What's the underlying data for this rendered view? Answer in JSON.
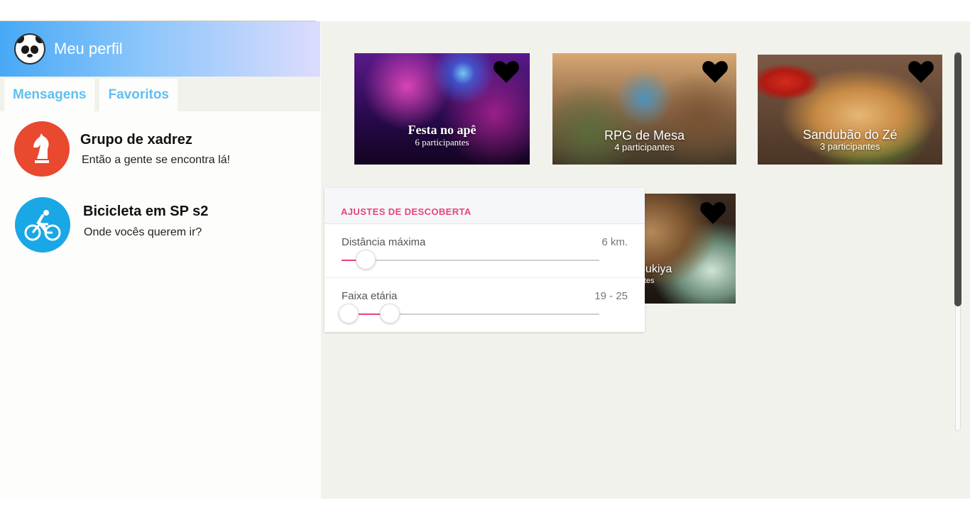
{
  "profile": {
    "title": "Meu perfil",
    "avatar_icon": "panda-icon"
  },
  "tabs": [
    {
      "label": "Mensagens"
    },
    {
      "label": "Favoritos"
    }
  ],
  "chats": [
    {
      "name": "Grupo de xadrez",
      "last_message": "Então a gente se encontra lá!",
      "icon": "chess-knight-icon",
      "color": "#e8492f"
    },
    {
      "name": "Bicicleta em SP s2",
      "last_message": "Onde vocês querem ir?",
      "icon": "cyclist-icon",
      "color": "#1aa7e5"
    }
  ],
  "cards": [
    {
      "title": "Festa no apê",
      "subtitle": "6 participantes",
      "favorite_icon": "heart-icon"
    },
    {
      "title": "RPG de Mesa",
      "subtitle": "4 participantes",
      "favorite_icon": "heart-icon"
    },
    {
      "title": "Sandubão do Zé",
      "subtitle": "3 participantes",
      "favorite_icon": "heart-icon"
    },
    {
      "title": "no Sukiya",
      "subtitle": "ipantes",
      "favorite_icon": "heart-icon"
    }
  ],
  "discovery": {
    "title": "AJUSTES DE DESCOBERTA",
    "max_distance": {
      "label": "Distância máxima",
      "value_text": "6 km.",
      "fraction": 0.05
    },
    "age_range": {
      "label": "Faixa etária",
      "value_text": "19 - 25",
      "low_fraction": 0.0,
      "high_fraction": 0.16
    }
  },
  "colors": {
    "accent": "#e9447c",
    "tab_text": "#5fbff2"
  }
}
